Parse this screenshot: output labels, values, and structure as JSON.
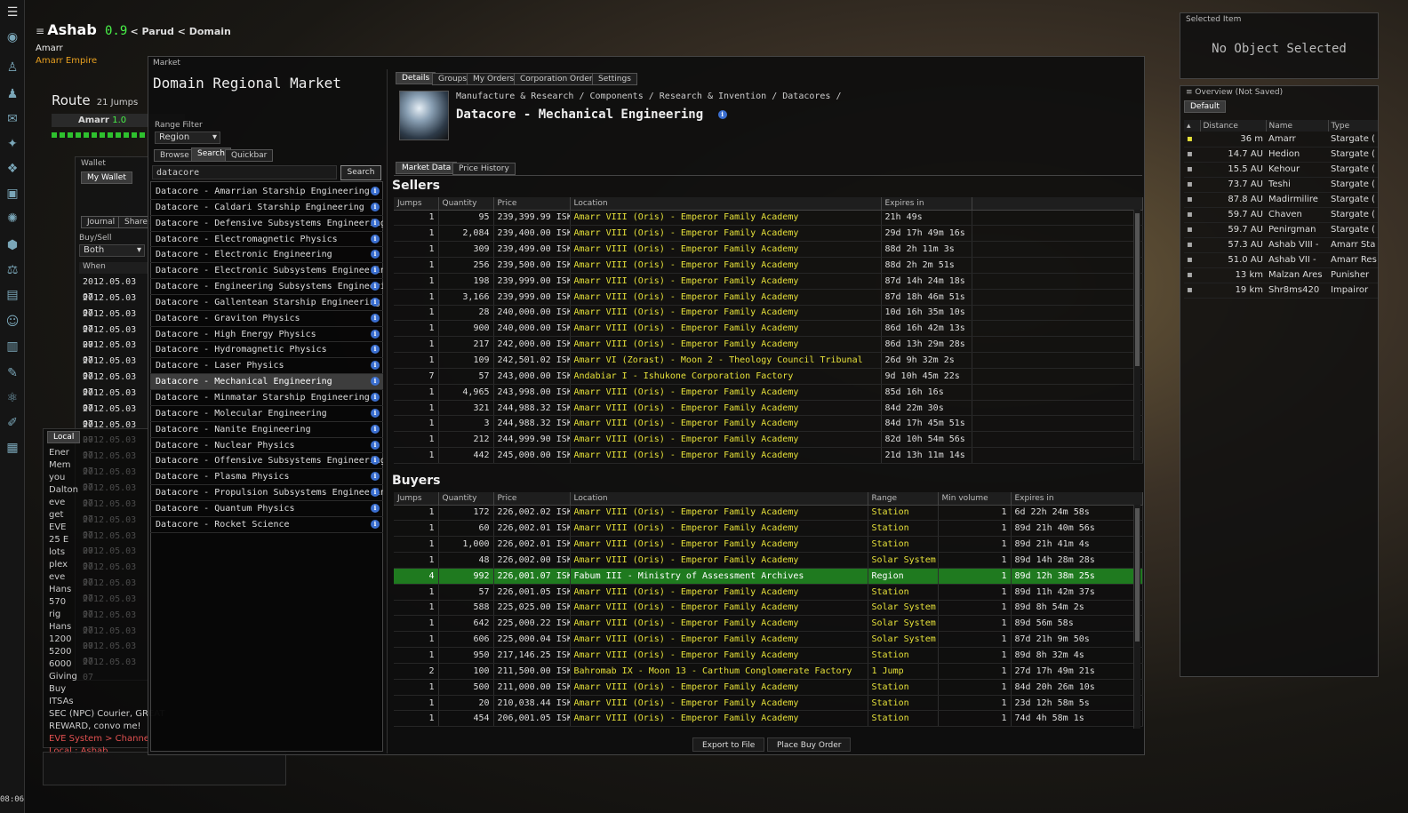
{
  "system": {
    "name": "Ashab",
    "security": "0.9",
    "path": "< Parud < Domain",
    "constellation": "Amarr",
    "region": "Amarr Empire"
  },
  "route": {
    "label": "Route",
    "jumps": "21 Jumps",
    "destination": "Amarr",
    "destination_sec": "1.0"
  },
  "clock": "08:06",
  "market": {
    "window_label": "Market",
    "title": "Domain Regional Market",
    "range_filter_label": "Range Filter",
    "range_value": "Region",
    "left_tabs": [
      "Browse",
      "Search",
      "Quickbar"
    ],
    "search_value": "datacore",
    "search_button": "Search",
    "results": [
      "Datacore - Amarrian Starship Engineering",
      "Datacore - Caldari Starship Engineering",
      "Datacore - Defensive Subsystems Engineering",
      "Datacore - Electromagnetic Physics",
      "Datacore - Electronic Engineering",
      "Datacore - Electronic Subsystems Engineering",
      "Datacore - Engineering Subsystems Engineering",
      "Datacore - Gallentean Starship Engineering",
      "Datacore - Graviton Physics",
      "Datacore - High Energy Physics",
      "Datacore - Hydromagnetic Physics",
      "Datacore - Laser Physics",
      "Datacore - Mechanical Engineering",
      "Datacore - Minmatar Starship Engineering",
      "Datacore - Molecular Engineering",
      "Datacore - Nanite Engineering",
      "Datacore - Nuclear Physics",
      "Datacore - Offensive Subsystems Engineering",
      "Datacore - Plasma Physics",
      "Datacore - Propulsion Subsystems Engineering",
      "Datacore - Quantum Physics",
      "Datacore - Rocket Science"
    ],
    "selected_result_index": 12,
    "detail_tabs": [
      "Details",
      "Groups",
      "My Orders",
      "Corporation Orders",
      "Settings"
    ],
    "breadcrumb": "Manufacture & Research / Components / Research & Invention / Datacores /",
    "item_name": "Datacore - Mechanical Engineering",
    "sub_tabs": [
      "Market Data",
      "Price History"
    ],
    "sellers_title": "Sellers",
    "seller_headers": [
      "Jumps",
      "Quantity",
      "Price",
      "Location",
      "Expires in"
    ],
    "sellers": [
      [
        "1",
        "95",
        "239,399.99 ISK",
        "Amarr VIII (Oris) - Emperor Family Academy",
        "21h 49s"
      ],
      [
        "1",
        "2,084",
        "239,400.00 ISK",
        "Amarr VIII (Oris) - Emperor Family Academy",
        "29d 17h 49m 16s"
      ],
      [
        "1",
        "309",
        "239,499.00 ISK",
        "Amarr VIII (Oris) - Emperor Family Academy",
        "88d 2h 11m 3s"
      ],
      [
        "1",
        "256",
        "239,500.00 ISK",
        "Amarr VIII (Oris) - Emperor Family Academy",
        "88d 2h 2m 51s"
      ],
      [
        "1",
        "198",
        "239,999.00 ISK",
        "Amarr VIII (Oris) - Emperor Family Academy",
        "87d 14h 24m 18s"
      ],
      [
        "1",
        "3,166",
        "239,999.00 ISK",
        "Amarr VIII (Oris) - Emperor Family Academy",
        "87d 18h 46m 51s"
      ],
      [
        "1",
        "28",
        "240,000.00 ISK",
        "Amarr VIII (Oris) - Emperor Family Academy",
        "10d 16h 35m 10s"
      ],
      [
        "1",
        "900",
        "240,000.00 ISK",
        "Amarr VIII (Oris) - Emperor Family Academy",
        "86d 16h 42m 13s"
      ],
      [
        "1",
        "217",
        "242,000.00 ISK",
        "Amarr VIII (Oris) - Emperor Family Academy",
        "86d 13h 29m 28s"
      ],
      [
        "1",
        "109",
        "242,501.02 ISK",
        "Amarr VI (Zorast) - Moon 2 - Theology Council Tribunal",
        "26d 9h 32m 2s"
      ],
      [
        "7",
        "57",
        "243,000.00 ISK",
        "Andabiar I - Ishukone Corporation Factory",
        "9d 10h 45m 22s"
      ],
      [
        "1",
        "4,965",
        "243,998.00 ISK",
        "Amarr VIII (Oris) - Emperor Family Academy",
        "85d 16h 16s"
      ],
      [
        "1",
        "321",
        "244,988.32 ISK",
        "Amarr VIII (Oris) - Emperor Family Academy",
        "84d 22m 30s"
      ],
      [
        "1",
        "3",
        "244,988.32 ISK",
        "Amarr VIII (Oris) - Emperor Family Academy",
        "84d 17h 45m 51s"
      ],
      [
        "1",
        "212",
        "244,999.90 ISK",
        "Amarr VIII (Oris) - Emperor Family Academy",
        "82d 10h 54m 56s"
      ],
      [
        "1",
        "442",
        "245,000.00 ISK",
        "Amarr VIII (Oris) - Emperor Family Academy",
        "21d 13h 11m 14s"
      ]
    ],
    "buyers_title": "Buyers",
    "buyer_headers": [
      "Jumps",
      "Quantity",
      "Price",
      "Location",
      "Range",
      "Min volume",
      "Expires in"
    ],
    "buyers": [
      [
        "1",
        "172",
        "226,002.02 ISK",
        "Amarr VIII (Oris) - Emperor Family Academy",
        "Station",
        "1",
        "6d 22h 24m 58s"
      ],
      [
        "1",
        "60",
        "226,002.01 ISK",
        "Amarr VIII (Oris) - Emperor Family Academy",
        "Station",
        "1",
        "89d 21h 40m 56s"
      ],
      [
        "1",
        "1,000",
        "226,002.01 ISK",
        "Amarr VIII (Oris) - Emperor Family Academy",
        "Station",
        "1",
        "89d 21h 41m 4s"
      ],
      [
        "1",
        "48",
        "226,002.00 ISK",
        "Amarr VIII (Oris) - Emperor Family Academy",
        "Solar System",
        "1",
        "89d 14h 28m 28s"
      ],
      [
        "4",
        "992",
        "226,001.07 ISK",
        "Fabum III - Ministry of Assessment Archives",
        "Region",
        "1",
        "89d 12h 38m 25s"
      ],
      [
        "1",
        "57",
        "226,001.05 ISK",
        "Amarr VIII (Oris) - Emperor Family Academy",
        "Station",
        "1",
        "89d 11h 42m 37s"
      ],
      [
        "1",
        "588",
        "225,025.00 ISK",
        "Amarr VIII (Oris) - Emperor Family Academy",
        "Solar System",
        "1",
        "89d 8h 54m 2s"
      ],
      [
        "1",
        "642",
        "225,000.22 ISK",
        "Amarr VIII (Oris) - Emperor Family Academy",
        "Solar System",
        "1",
        "89d 56m 58s"
      ],
      [
        "1",
        "606",
        "225,000.04 ISK",
        "Amarr VIII (Oris) - Emperor Family Academy",
        "Solar System",
        "1",
        "87d 21h 9m 50s"
      ],
      [
        "1",
        "950",
        "217,146.25 ISK",
        "Amarr VIII (Oris) - Emperor Family Academy",
        "Station",
        "1",
        "89d 8h 32m 4s"
      ],
      [
        "2",
        "100",
        "211,500.00 ISK",
        "Bahromab IX - Moon 13 - Carthum Conglomerate Factory",
        "1 Jump",
        "1",
        "27d 17h 49m 21s"
      ],
      [
        "1",
        "500",
        "211,000.00 ISK",
        "Amarr VIII (Oris) - Emperor Family Academy",
        "Station",
        "1",
        "84d 20h 26m 10s"
      ],
      [
        "1",
        "20",
        "210,038.44 ISK",
        "Amarr VIII (Oris) - Emperor Family Academy",
        "Station",
        "1",
        "23d 12h 58m 5s"
      ],
      [
        "1",
        "454",
        "206,001.05 ISK",
        "Amarr VIII (Oris) - Emperor Family Academy",
        "Station",
        "1",
        "74d 4h 58m 1s"
      ]
    ],
    "highlighted_buyer_index": 4,
    "export_button": "Export to File",
    "buy_order_button": "Place Buy Order"
  },
  "wallet": {
    "title": "Wallet",
    "tab": "My Wallet",
    "journal_tab": "Journal",
    "shares_tab": "Shares",
    "buysell_label": "Buy/Sell",
    "buysell_value": "Both",
    "when_header": "When",
    "date": "2012.05.03 07"
  },
  "selected_item": {
    "title": "Selected Item",
    "text": "No Object Selected"
  },
  "overview": {
    "title": "Overview (Not Saved)",
    "tab": "Default",
    "headers": [
      "Distance",
      "Name",
      "Type"
    ],
    "rows": [
      [
        "36 m",
        "Amarr",
        "Stargate ("
      ],
      [
        "14.7 AU",
        "Hedion",
        "Stargate ("
      ],
      [
        "15.5 AU",
        "Kehour",
        "Stargate ("
      ],
      [
        "73.7 AU",
        "Teshi",
        "Stargate ("
      ],
      [
        "87.8 AU",
        "Madirmilire",
        "Stargate ("
      ],
      [
        "59.7 AU",
        "Chaven",
        "Stargate ("
      ],
      [
        "59.7 AU",
        "Penirgman",
        "Stargate ("
      ],
      [
        "57.3 AU",
        "Ashab VIII -",
        "Amarr Sta"
      ],
      [
        "51.0 AU",
        "Ashab VII -",
        "Amarr Res"
      ],
      [
        "13 km",
        "Malzan Ares",
        "Punisher"
      ],
      [
        "19 km",
        "Shr8ms420",
        "Impairor"
      ]
    ]
  },
  "chat": {
    "tab": "Local",
    "lines": [
      "Ener",
      "Mem",
      "you",
      "Dalton",
      "eve",
      "get",
      "EVE",
      "25 E",
      "lots",
      "plex",
      "eve",
      "Hans",
      "570",
      "rig",
      "Hans",
      "1200",
      "5200",
      "6000",
      "Giving",
      "Buy",
      "ITSAs",
      "SEC (NPC) Courier, GREAT",
      "REWARD, convo me!",
      "EVE System > Channe",
      "Local : Ashab"
    ]
  },
  "colors": {
    "location_yellow": "#e6e13a",
    "highlight_green": "#1f7a1f",
    "security_green": "#48f048",
    "region_orange": "#e8a020"
  }
}
